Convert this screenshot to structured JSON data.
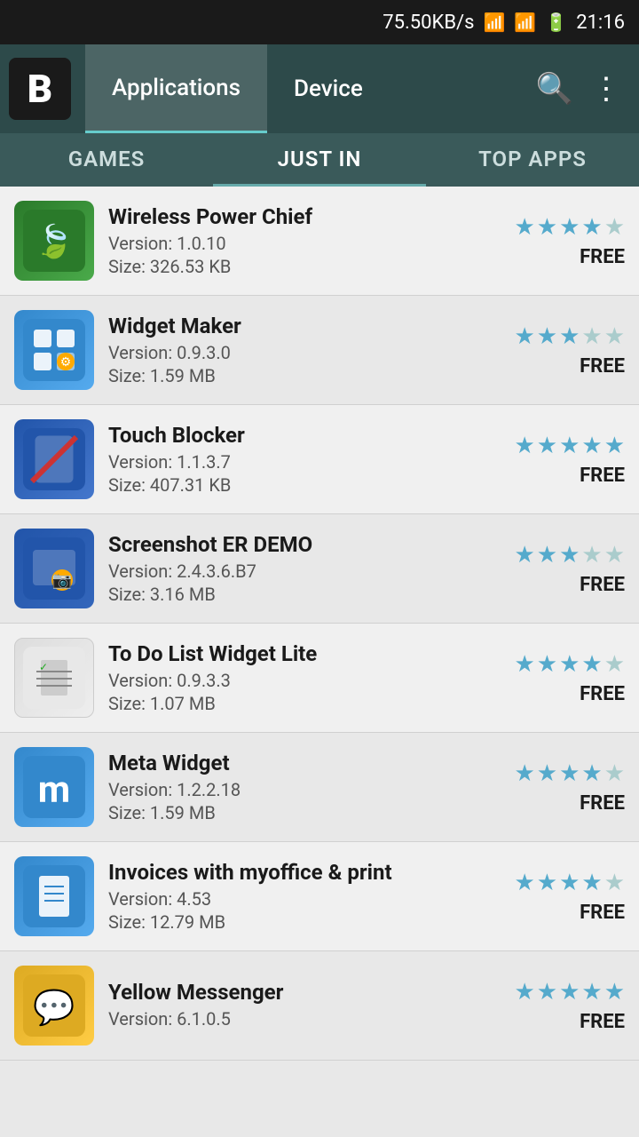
{
  "statusBar": {
    "speed": "75.50KB/s",
    "time": "21:16"
  },
  "header": {
    "logoLetter": "B",
    "tabs": [
      {
        "label": "Applications",
        "active": true
      },
      {
        "label": "Device",
        "active": false
      }
    ],
    "searchIcon": "🔍",
    "menuIcon": "⋮"
  },
  "categoryTabs": [
    {
      "label": "GAMES",
      "active": false
    },
    {
      "label": "JUST IN",
      "active": true
    },
    {
      "label": "TOP APPS",
      "active": false
    }
  ],
  "apps": [
    {
      "name": "Wireless Power Chief",
      "version": "Version: 1.0.10",
      "size": "Size: 326.53 KB",
      "stars": 4,
      "maxStars": 5,
      "price": "FREE",
      "iconType": "wireless"
    },
    {
      "name": "Widget Maker",
      "version": "Version: 0.9.3.0",
      "size": "Size: 1.59 MB",
      "stars": 3,
      "maxStars": 5,
      "price": "FREE",
      "iconType": "widget-maker"
    },
    {
      "name": "Touch Blocker",
      "version": "Version: 1.1.3.7",
      "size": "Size: 407.31 KB",
      "stars": 5,
      "maxStars": 5,
      "price": "FREE",
      "iconType": "touch-blocker"
    },
    {
      "name": "Screenshot ER DEMO",
      "version": "Version: 2.4.3.6.B7",
      "size": "Size: 3.16 MB",
      "stars": 3,
      "maxStars": 5,
      "price": "FREE",
      "iconType": "screenshot"
    },
    {
      "name": "To Do List Widget Lite",
      "version": "Version: 0.9.3.3",
      "size": "Size: 1.07 MB",
      "stars": 4,
      "maxStars": 5,
      "price": "FREE",
      "iconType": "todo"
    },
    {
      "name": "Meta Widget",
      "version": "Version: 1.2.2.18",
      "size": "Size: 1.59 MB",
      "stars": 4,
      "maxStars": 5,
      "price": "FREE",
      "iconType": "meta"
    },
    {
      "name": "Invoices with myoffice & print",
      "version": "Version: 4.53",
      "size": "Size: 12.79 MB",
      "stars": 4,
      "maxStars": 5,
      "price": "FREE",
      "iconType": "invoices"
    },
    {
      "name": "Yellow Messenger",
      "version": "Version: 6.1.0.5",
      "size": "",
      "stars": 5,
      "maxStars": 5,
      "price": "FREE",
      "iconType": "yellow"
    }
  ]
}
